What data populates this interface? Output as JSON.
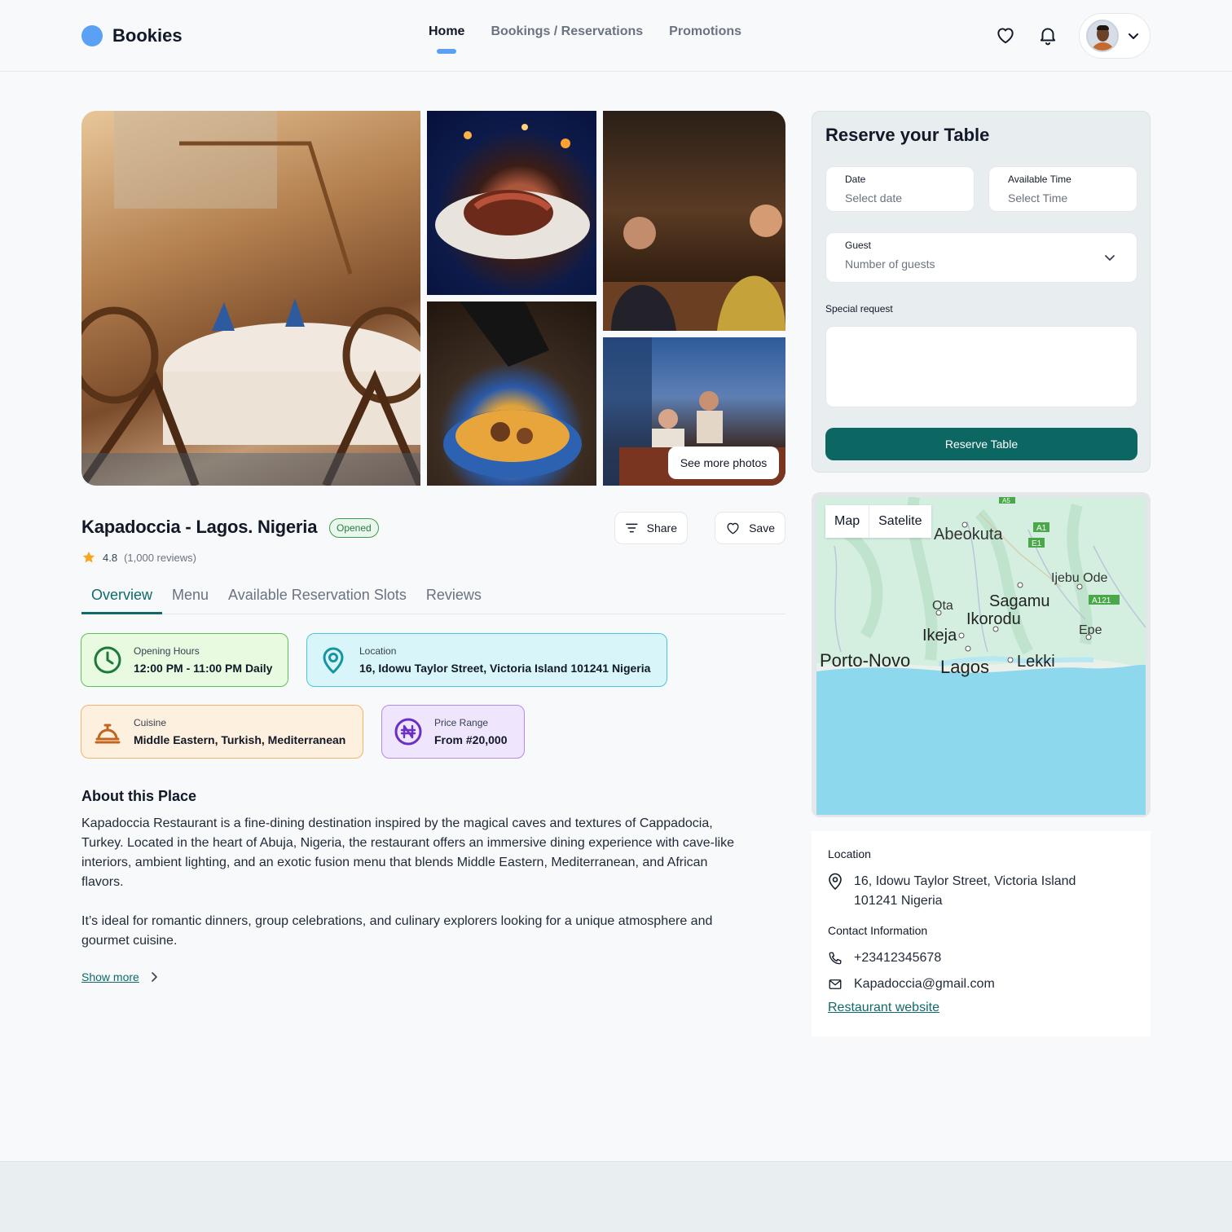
{
  "header": {
    "brand": "Bookies",
    "nav": [
      "Home",
      "Bookings / Reservations",
      "Promotions"
    ],
    "active_nav": "Home"
  },
  "gallery": {
    "see_more_label": "See more photos"
  },
  "restaurant": {
    "name": "Kapadoccia - Lagos. Nigeria",
    "status": "Opened",
    "rating": "4.8",
    "reviews": "(1,000 reviews)",
    "share_label": "Share",
    "save_label": "Save"
  },
  "tabs": [
    "Overview",
    "Menu",
    "Available Reservation Slots",
    "Reviews"
  ],
  "info_cards": {
    "hours": {
      "label": "Opening Hours",
      "value": "12:00 PM - 11:00 PM Daily"
    },
    "location": {
      "label": "Location",
      "value": "16, Idowu Taylor Street, Victoria Island 101241 Nigeria"
    },
    "cuisine": {
      "label": "Cuisine",
      "value": "Middle Eastern, Turkish, Mediterranean"
    },
    "price": {
      "label": "Price Range",
      "value": "From #20,000"
    }
  },
  "about": {
    "heading": "About this Place",
    "p1_line1": "Kapadoccia Restaurant is a fine-dining destination inspired by the magical caves and textures of Cappadocia,",
    "p1_line2": "Turkey. Located in the heart of Abuja, Nigeria, the restaurant offers an immersive dining experience with cave-like",
    "p1_line3": "interiors, ambient lighting, and an exotic fusion menu that blends Middle Eastern, Mediterranean, and African",
    "p1_line4": "flavors.",
    "p2_line1": "It’s ideal for romantic dinners, group celebrations, and culinary explorers looking for a unique atmosphere and",
    "p2_line2": "gourmet cuisine.",
    "show_more": "Show more"
  },
  "reserve": {
    "heading": "Reserve your Table",
    "date_label": "Date",
    "date_placeholder": "Select date",
    "time_label": "Available Time",
    "time_placeholder": "Select Time",
    "guest_label": "Guest",
    "guest_placeholder": "Number of guests",
    "special_label": "Special request",
    "button": "Reserve Table"
  },
  "map": {
    "toggle": [
      "Map",
      "Satelite"
    ],
    "places": {
      "abeokuta": "Abeokuta",
      "ijebu_ode": "Ijebu Ode",
      "ota": "Ota",
      "sagamu": "Sagamu",
      "ikorodu": "Ikorodu",
      "ikeja": "Ikeja",
      "epe": "Epe",
      "porto_novo": "Porto-Novo",
      "lagos": "Lagos",
      "lekki": "Lekki"
    },
    "road_labels": {
      "a1": "A1",
      "e1": "E1",
      "a121": "A121",
      "a5": "A5"
    }
  },
  "contact": {
    "location_heading": "Location",
    "address_line1": "16, Idowu Taylor Street, Victoria Island",
    "address_line2": "101241 Nigeria",
    "contact_heading": "Contact Information",
    "phone": "+23412345678",
    "email": "Kapadoccia@gmail.com",
    "website": "Restaurant website"
  },
  "colors": {
    "accent": "#0f6a6a",
    "brand_dot": "#5aa0f5",
    "reserve_button": "#0c6661",
    "map_water": "#8dd8ec",
    "map_land": "#cfeedd"
  }
}
